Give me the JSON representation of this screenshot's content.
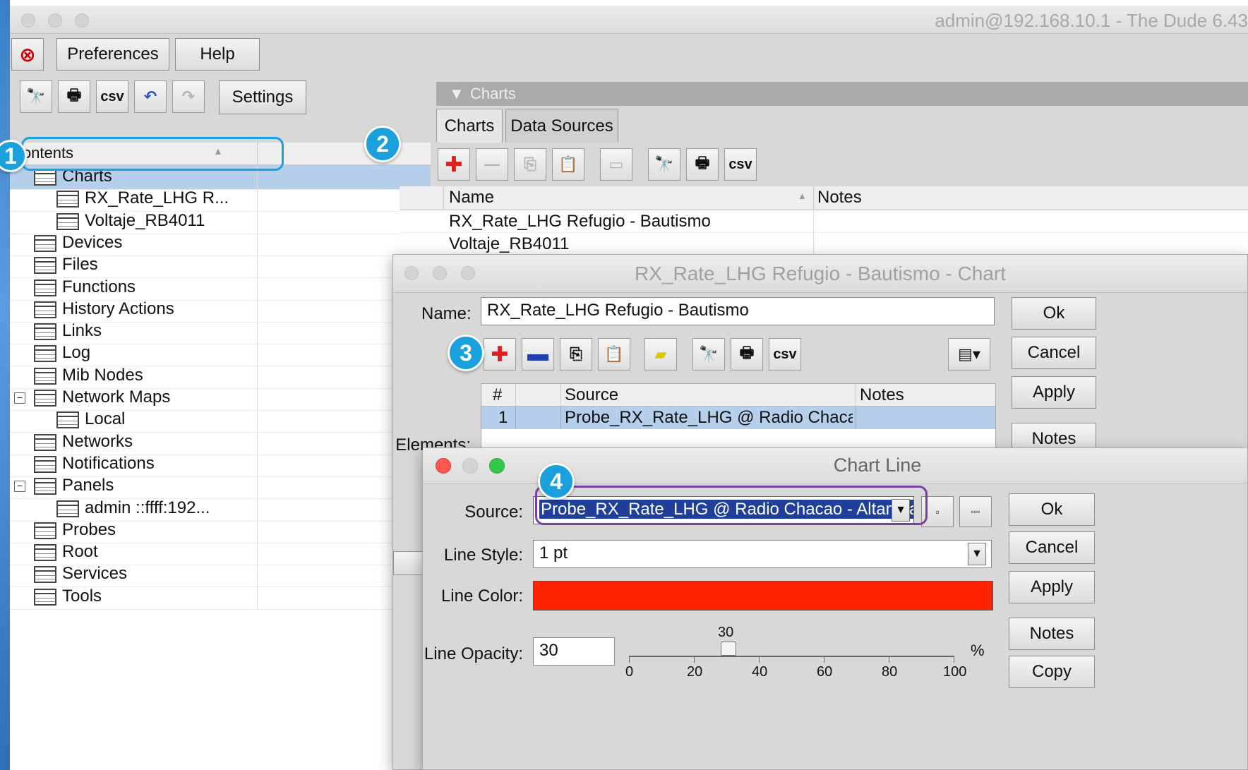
{
  "window": {
    "title": "admin@192.168.10.1 - The Dude 6.43"
  },
  "toolbar": {
    "preferences_label": "Preferences",
    "help_label": "Help",
    "settings_label": "Settings",
    "csv_label": "csv"
  },
  "tree": {
    "header": "Contents",
    "items": [
      {
        "label": "Charts",
        "level": 0,
        "selected": true
      },
      {
        "label": "RX_Rate_LHG R...",
        "level": 1
      },
      {
        "label": "Voltaje_RB4011",
        "level": 1
      },
      {
        "label": "Devices",
        "level": 0
      },
      {
        "label": "Files",
        "level": 0
      },
      {
        "label": "Functions",
        "level": 0
      },
      {
        "label": "History Actions",
        "level": 0
      },
      {
        "label": "Links",
        "level": 0
      },
      {
        "label": "Log",
        "level": 0
      },
      {
        "label": "Mib Nodes",
        "level": 0
      },
      {
        "label": "Network Maps",
        "level": 0,
        "expander": "−"
      },
      {
        "label": "Local",
        "level": 1
      },
      {
        "label": "Networks",
        "level": 0
      },
      {
        "label": "Notifications",
        "level": 0
      },
      {
        "label": "Panels",
        "level": 0,
        "expander": "−"
      },
      {
        "label": "admin ::ffff:192...",
        "level": 1
      },
      {
        "label": "Probes",
        "level": 0
      },
      {
        "label": "Root",
        "level": 0
      },
      {
        "label": "Services",
        "level": 0
      },
      {
        "label": "Tools",
        "level": 0
      }
    ]
  },
  "charts_panel": {
    "title": "Charts",
    "tabs": [
      "Charts",
      "Data Sources"
    ],
    "columns": [
      "Name",
      "Notes"
    ],
    "rows": [
      {
        "name": "RX_Rate_LHG Refugio - Bautismo",
        "notes": ""
      },
      {
        "name": "Voltaje_RB4011",
        "notes": ""
      }
    ]
  },
  "chart_dialog": {
    "title": "RX_Rate_LHG Refugio - Bautismo - Chart",
    "name_label": "Name:",
    "name_value": "RX_Rate_LHG Refugio - Bautismo",
    "elements_label": "Elements:",
    "columns": [
      "#",
      "",
      "Source",
      "Notes"
    ],
    "rows": [
      {
        "num": "1",
        "source": "Probe_RX_Rate_LHG @ Radio Chaca...",
        "notes": ""
      }
    ],
    "buttons": [
      "Ok",
      "Cancel",
      "Apply",
      "Notes"
    ]
  },
  "chart_line_dialog": {
    "title": "Chart Line",
    "source_label": "Source:",
    "source_value": "Probe_RX_Rate_LHG @ Radio Chacao - Altamira",
    "line_style_label": "Line Style:",
    "line_style_value": "1 pt",
    "line_color_label": "Line Color:",
    "line_color": "#ff2200",
    "line_opacity_label": "Line Opacity:",
    "line_opacity_value": "30",
    "slider_value": "30",
    "slider_unit": "%",
    "slider_ticks": [
      "0",
      "20",
      "40",
      "60",
      "80",
      "100"
    ],
    "small_btn_1": "▫",
    "small_btn_2": "▫▫▫",
    "buttons": [
      "Ok",
      "Cancel",
      "Apply",
      "Notes",
      "Copy"
    ]
  },
  "callouts": [
    "1",
    "2",
    "3",
    "4"
  ],
  "colors": {
    "callout": "#1aa0dc",
    "selection": "#b6cfec",
    "highlight_ring_blue": "#1aa0dc",
    "highlight_ring_purple": "#7b3fa0"
  }
}
